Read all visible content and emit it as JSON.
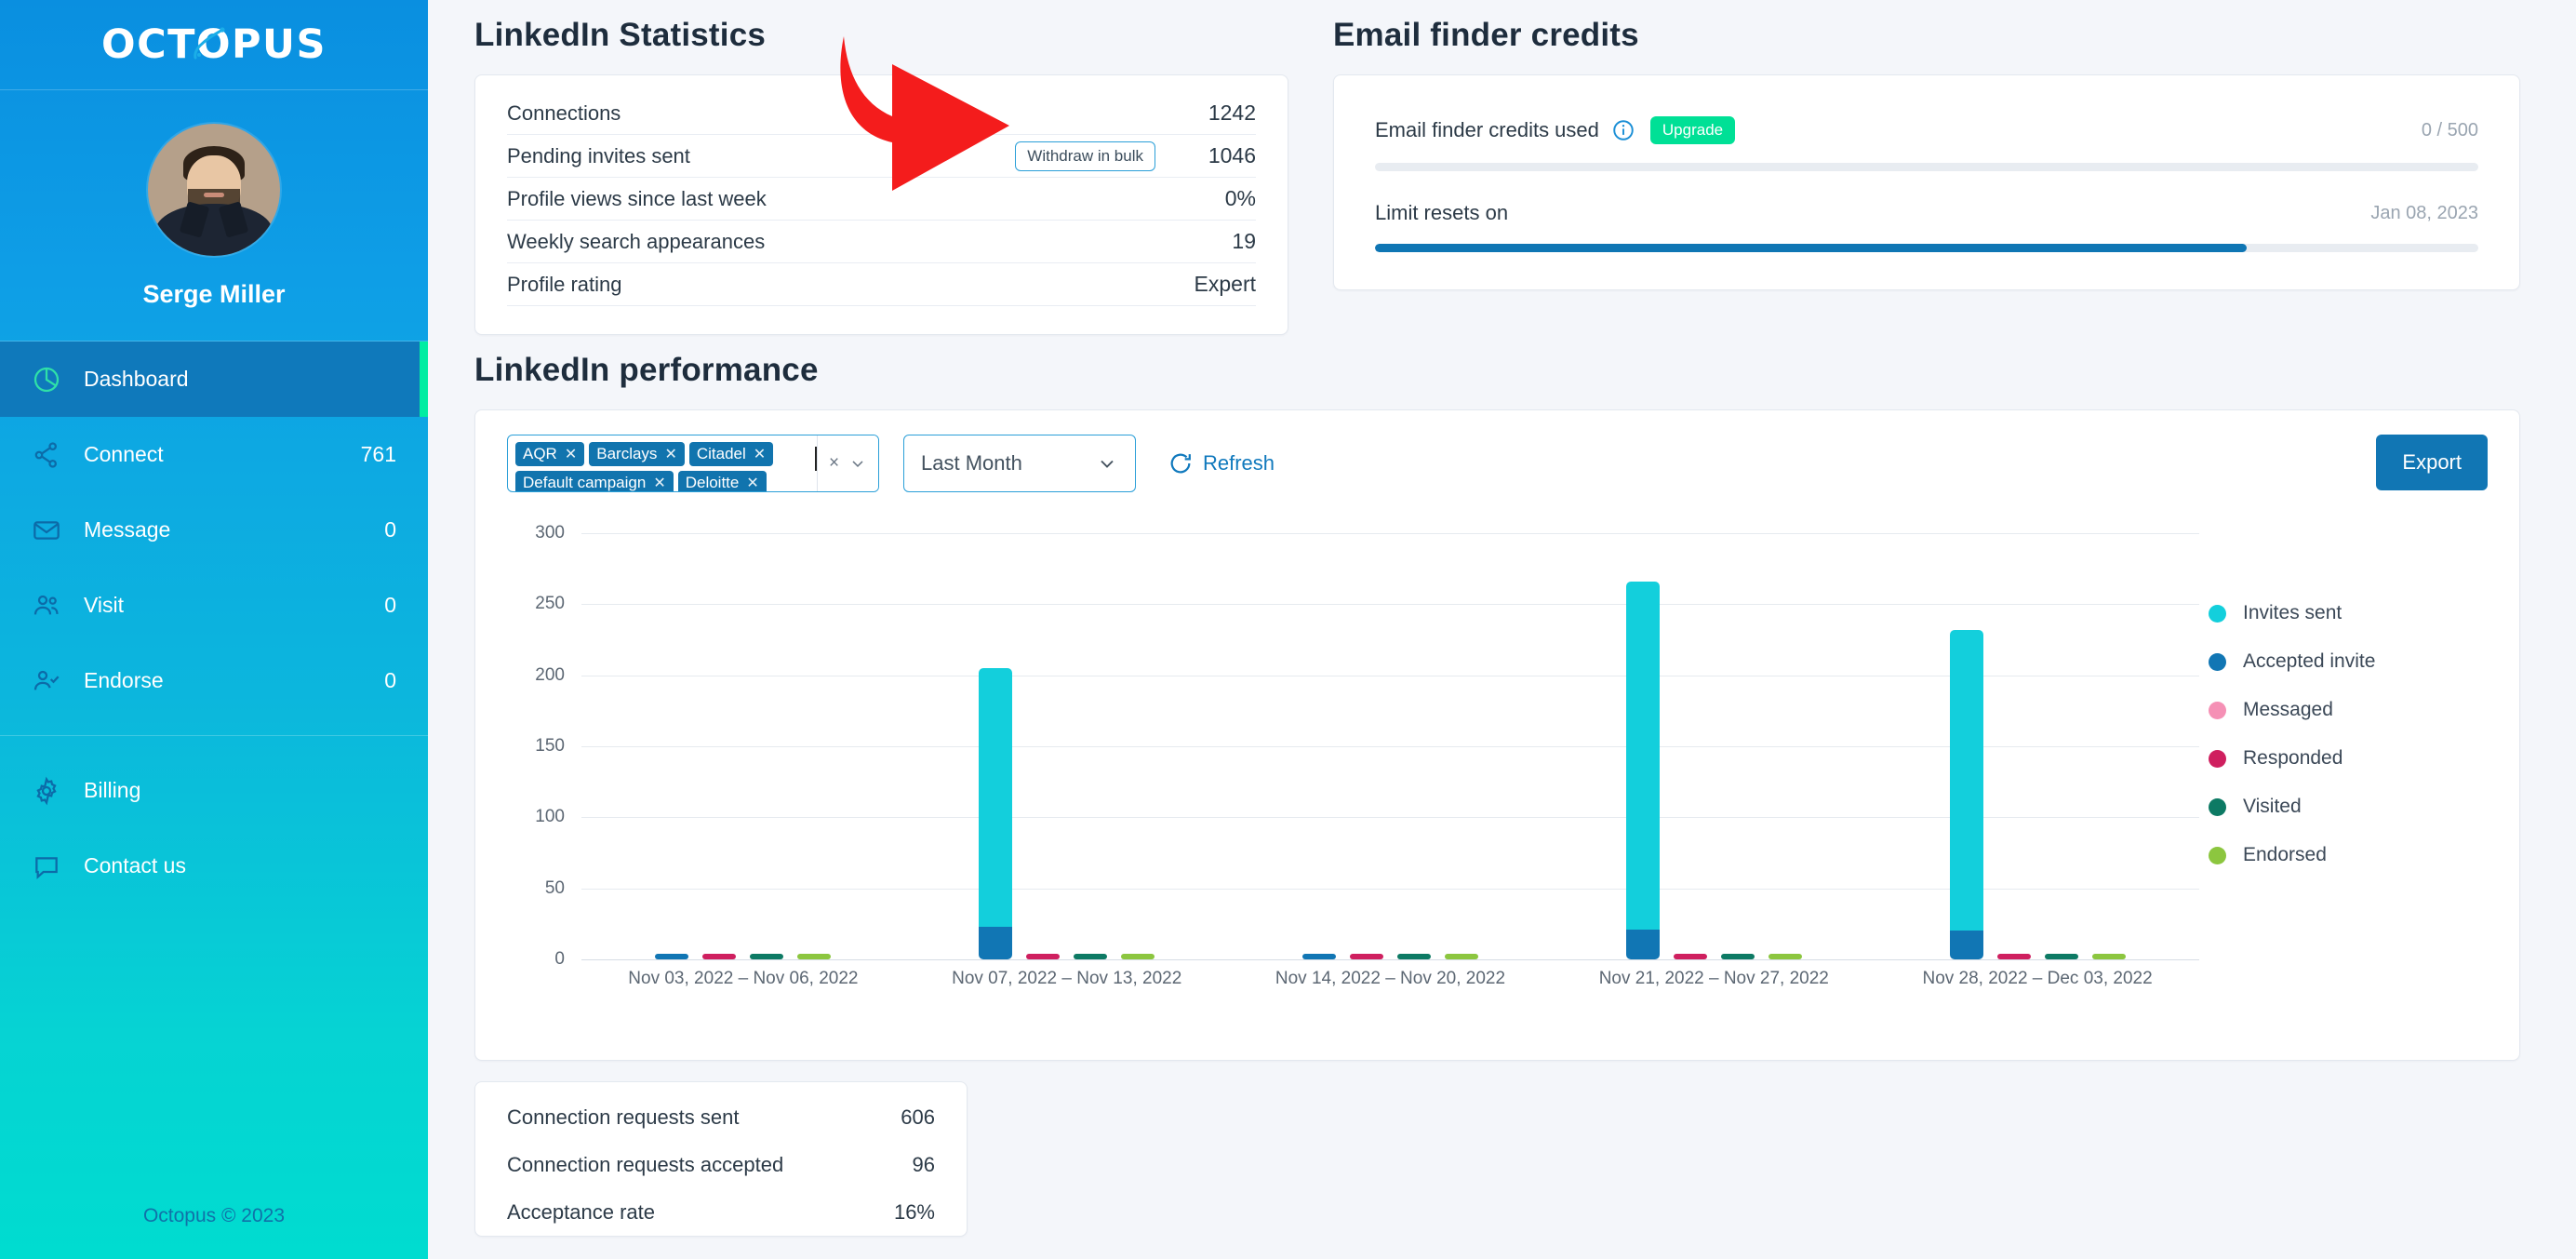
{
  "brand": {
    "logo_text": "OCTOPUS",
    "footer": "Octopus © 2023"
  },
  "profile": {
    "name": "Serge Miller",
    "avatar_alt": "user-avatar"
  },
  "sidebar": {
    "items": [
      {
        "label": "Dashboard",
        "count": "",
        "icon": "pie-chart-icon",
        "active": true
      },
      {
        "label": "Connect",
        "count": "761",
        "icon": "share-nodes-icon",
        "active": false
      },
      {
        "label": "Message",
        "count": "0",
        "icon": "envelope-icon",
        "active": false
      },
      {
        "label": "Visit",
        "count": "0",
        "icon": "users-icon",
        "active": false
      },
      {
        "label": "Endorse",
        "count": "0",
        "icon": "user-check-icon",
        "active": false
      }
    ],
    "secondary": [
      {
        "label": "Billing",
        "count": "",
        "icon": "gear-icon"
      },
      {
        "label": "Contact us",
        "count": "",
        "icon": "chat-bubble-icon"
      }
    ]
  },
  "linkedin_statistics": {
    "title": "LinkedIn Statistics",
    "withdraw_button": "Withdraw in bulk",
    "rows": [
      {
        "label": "Connections",
        "value": "1242",
        "has_button": false
      },
      {
        "label": "Pending invites sent",
        "value": "1046",
        "has_button": true
      },
      {
        "label": "Profile views since last week",
        "value": "0%",
        "has_button": false
      },
      {
        "label": "Weekly search appearances",
        "value": "19",
        "has_button": false
      },
      {
        "label": "Profile rating",
        "value": "Expert",
        "has_button": false
      }
    ]
  },
  "email_finder_credits": {
    "title": "Email finder credits",
    "used_label": "Email finder credits used",
    "upgrade_label": "Upgrade",
    "used_value": "0 / 500",
    "used_percent": 0,
    "reset_label": "Limit resets on",
    "reset_value": "Jan 08, 2023",
    "reset_percent": 79
  },
  "performance": {
    "title": "LinkedIn performance",
    "campaign_chips": [
      {
        "label": "AQR"
      },
      {
        "label": "Barclays"
      },
      {
        "label": "Citadel"
      },
      {
        "label": "Default campaign"
      },
      {
        "label": "Deloitte"
      }
    ],
    "clear_all": "×",
    "period_value": "Last Month",
    "refresh_label": "Refresh",
    "export_label": "Export"
  },
  "summary": {
    "rows": [
      {
        "label": "Connection requests sent",
        "value": "606"
      },
      {
        "label": "Connection requests accepted",
        "value": "96"
      },
      {
        "label": "Acceptance rate",
        "value": "16%"
      }
    ]
  },
  "colors": {
    "brand_blue": "#1176b4",
    "accent_green": "#00eda2",
    "upgrade_green": "#00e096",
    "invites_sent": "#13cfdc",
    "accepted_invite": "#1176b4",
    "messaged": "#f590b5",
    "responded": "#cf1f5f",
    "visited": "#0d7a64",
    "endorsed": "#8cc63f"
  },
  "chart_data": {
    "type": "bar",
    "title": "LinkedIn performance",
    "xlabel": "",
    "ylabel": "",
    "ylim": [
      0,
      300
    ],
    "yticks": [
      0,
      50,
      100,
      150,
      200,
      250,
      300
    ],
    "grid": true,
    "legend_position": "right",
    "stacked_note": "Invites sent stacks above Accepted invite in the first column of each group",
    "categories": [
      "Nov 03, 2022 – Nov 06, 2022",
      "Nov 07, 2022 – Nov 13, 2022",
      "Nov 14, 2022 – Nov 20, 2022",
      "Nov 21, 2022 – Nov 27, 2022",
      "Nov 28, 2022 – Dec 03, 2022"
    ],
    "series": [
      {
        "name": "Invites sent",
        "color": "#13cfdc",
        "values": [
          0,
          182,
          0,
          245,
          212
        ]
      },
      {
        "name": "Accepted invite",
        "color": "#1176b4",
        "values": [
          4,
          23,
          4,
          21,
          20
        ]
      },
      {
        "name": "Messaged",
        "color": "#f590b5",
        "values": [
          0,
          0,
          0,
          0,
          0
        ]
      },
      {
        "name": "Responded",
        "color": "#cf1f5f",
        "values": [
          4,
          4,
          4,
          4,
          4
        ]
      },
      {
        "name": "Visited",
        "color": "#0d7a64",
        "values": [
          4,
          4,
          4,
          4,
          4
        ]
      },
      {
        "name": "Endorsed",
        "color": "#8cc63f",
        "values": [
          4,
          4,
          4,
          4,
          4
        ]
      }
    ]
  }
}
